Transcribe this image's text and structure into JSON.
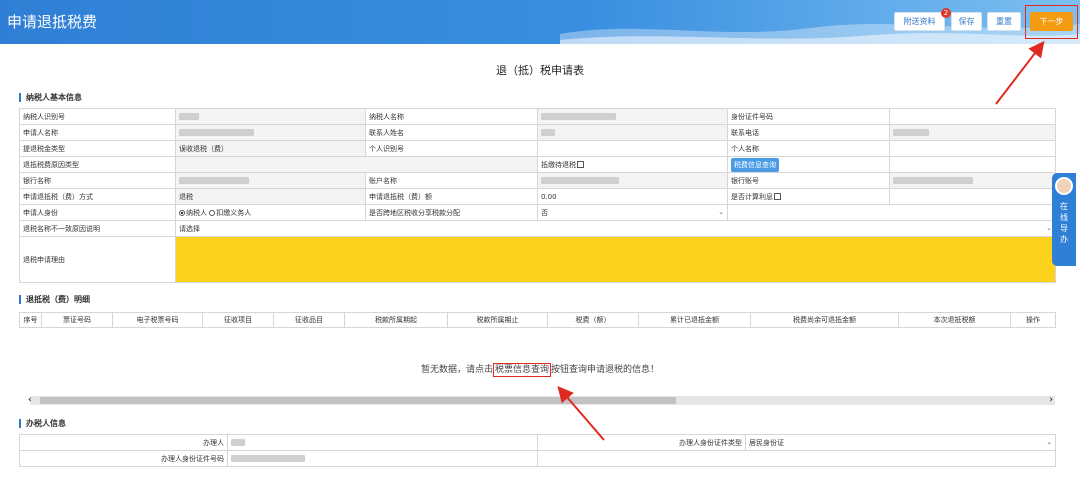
{
  "header": {
    "title": "申请退抵税费",
    "buttons": {
      "attach": "附送资料",
      "save": "保存",
      "reset": "重置",
      "next": "下一步"
    },
    "attach_badge": "2"
  },
  "form_title": "退（抵）税申请表",
  "sections": {
    "basic": "纳税人基本信息",
    "detail": "退抵税（费）明细",
    "handler": "办税人信息"
  },
  "basic": {
    "taxpayer_id_label": "纳税人识别号",
    "taxpayer_name_label": "纳税人名称",
    "id_number_label": "身份证件号码",
    "applicant_name_label": "申请人名称",
    "contact_name_label": "联系人姓名",
    "contact_phone_label": "联系电话",
    "refund_type_label": "提退税金类型",
    "refund_type_value": "误收退税（费）",
    "personal_id_label": "个人识别号",
    "personal_name_label": "个人名称",
    "reason_type_label": "退抵税费原因类型",
    "offset_label": "抵缴待退税",
    "query_button": "税费信息查询",
    "bank_name_label": "银行名称",
    "account_name_label": "账户名称",
    "bank_account_label": "银行账号",
    "method_label": "申请退抵税（费）方式",
    "method_value": "退税",
    "amount_label": "申请退抵税（费）额",
    "amount_value": "0.00",
    "interest_label": "是否计算利息",
    "identity_label": "申请人身份",
    "identity_opt1": "纳税人",
    "identity_opt2": "扣缴义务人",
    "cross_region_label": "是否跨地区税收分享税款分配",
    "cross_region_value": "否",
    "name_mismatch_label": "退税名称不一致原因说明",
    "name_mismatch_value": "请选择",
    "reason_label": "退税申请理由"
  },
  "detail": {
    "columns": [
      "序号",
      "票证号码",
      "电子税票号码",
      "征收项目",
      "征收品目",
      "税款所属期起",
      "税款所属期止",
      "税费（额）",
      "累计已退抵金额",
      "税费尚余可退抵金额",
      "本次退抵税额",
      "操作"
    ],
    "empty_before": "暂无数据，请点击",
    "empty_link": "税票信息查询",
    "empty_after": "按钮查询申请退税的信息！"
  },
  "handler": {
    "name_label": "办理人",
    "id_type_label": "办理人身份证件类型",
    "id_type_value": "居民身份证",
    "id_number_label": "办理人身份证件号码"
  },
  "side_assist": {
    "chars": [
      "在",
      "线",
      "导",
      "办"
    ]
  },
  "colors": {
    "header": "#2f7fd6",
    "accent": "#f49b12",
    "highlight": "#fcd21c",
    "annotation": "#e02a20"
  }
}
